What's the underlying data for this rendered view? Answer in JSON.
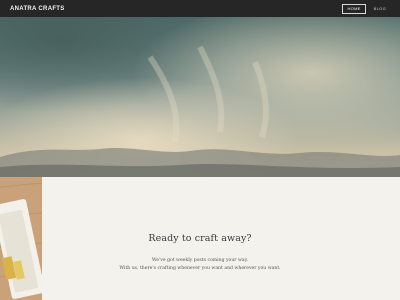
{
  "navbar": {
    "brand": "ANATRA CRAFTS",
    "links": [
      {
        "label": "HOME",
        "active": true
      },
      {
        "label": "BLOG",
        "active": false
      }
    ]
  },
  "hero": {
    "image": "cloudy-sky-photo"
  },
  "section": {
    "image": "craft-supplies-photo",
    "heading": "Ready to craft away?",
    "line1": "We've got weekly posts coming your way.",
    "line2": "With us, there's crafting whenever you want and wherever you want."
  },
  "colors": {
    "navbar_bg": "#262626",
    "content_bg": "#f4f2ec",
    "sky_teal": "#5e7a78",
    "cloud_warm": "#d8c4a0"
  }
}
